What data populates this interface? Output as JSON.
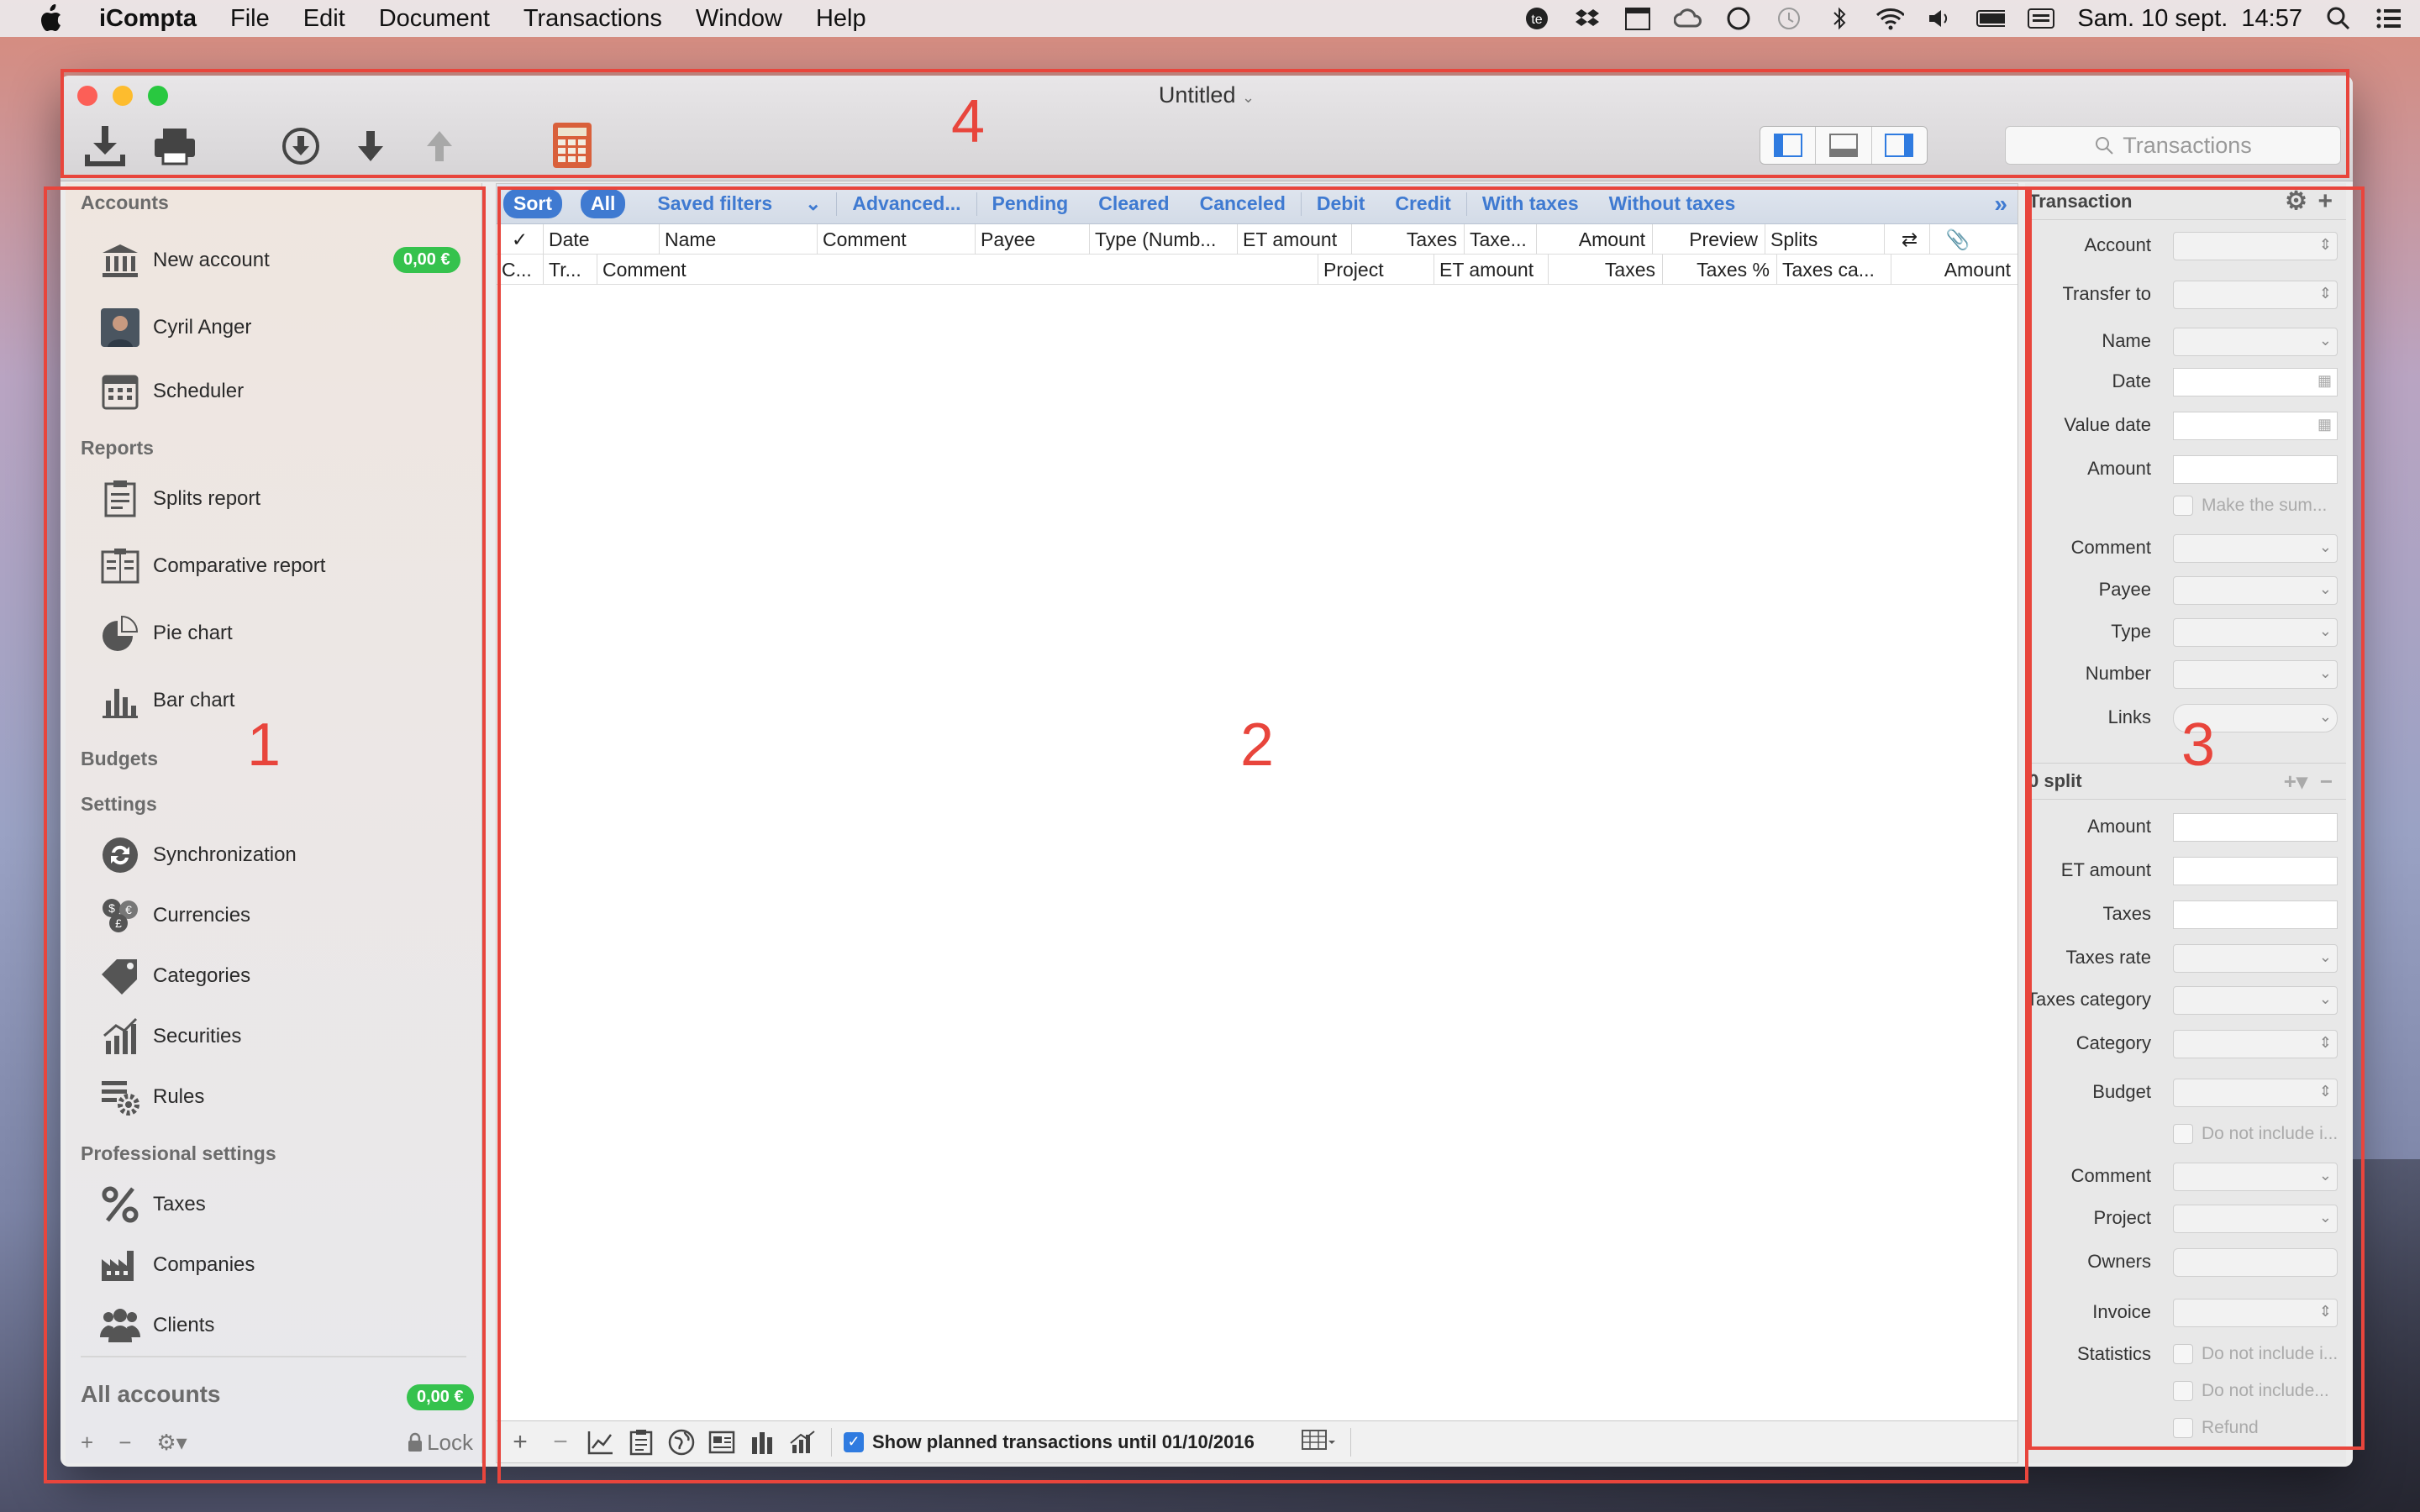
{
  "menubar": {
    "app": "iCompta",
    "items": [
      "File",
      "Edit",
      "Document",
      "Transactions",
      "Window",
      "Help"
    ],
    "datetime": "Sam. 10 sept.  14:57",
    "calendar_day": "10"
  },
  "window": {
    "title": "Untitled",
    "search_placeholder": "Transactions"
  },
  "sidebar": {
    "sections": {
      "accounts": "Accounts",
      "reports": "Reports",
      "budgets": "Budgets",
      "settings": "Settings",
      "professional": "Professional settings"
    },
    "items": {
      "new_account": "New account",
      "new_account_badge": "0,00 €",
      "cyril": "Cyril Anger",
      "scheduler": "Scheduler",
      "splits_report": "Splits report",
      "comparative_report": "Comparative report",
      "pie_chart": "Pie chart",
      "bar_chart": "Bar chart",
      "synchronization": "Synchronization",
      "currencies": "Currencies",
      "categories": "Categories",
      "securities": "Securities",
      "rules": "Rules",
      "taxes": "Taxes",
      "companies": "Companies",
      "clients": "Clients"
    },
    "all_accounts": "All accounts",
    "all_accounts_badge": "0,00 €",
    "lock": "Lock"
  },
  "filterbar": {
    "sort": "Sort",
    "all": "All",
    "saved_filters": "Saved filters",
    "advanced": "Advanced...",
    "pending": "Pending",
    "cleared": "Cleared",
    "canceled": "Canceled",
    "debit": "Debit",
    "credit": "Credit",
    "with_taxes": "With taxes",
    "without_taxes": "Without taxes"
  },
  "columns1": {
    "check": "✓",
    "date": "Date",
    "name": "Name",
    "comment": "Comment",
    "payee": "Payee",
    "type": "Type (Numb...",
    "et_amount": "ET amount",
    "taxes": "Taxes",
    "taxe": "Taxe...",
    "amount": "Amount",
    "preview": "Preview",
    "splits": "Splits"
  },
  "columns2": {
    "c": "C...",
    "tr": "Tr...",
    "comment": "Comment",
    "project": "Project",
    "et_amount": "ET amount",
    "taxes": "Taxes",
    "taxes_pct": "Taxes %",
    "taxes_ca": "Taxes ca...",
    "amount": "Amount"
  },
  "main_bottom": {
    "show_planned": "Show planned transactions until 01/10/2016"
  },
  "inspector": {
    "header": "Transaction",
    "account": "Account",
    "transfer_to": "Transfer to",
    "name": "Name",
    "date": "Date",
    "value_date": "Value date",
    "amount": "Amount",
    "make_sum": "Make the sum...",
    "comment": "Comment",
    "payee": "Payee",
    "type": "Type",
    "number": "Number",
    "links": "Links",
    "split_header": "0 split",
    "s_amount": "Amount",
    "s_et_amount": "ET amount",
    "s_taxes": "Taxes",
    "s_taxes_rate": "Taxes rate",
    "s_taxes_category": "Taxes category",
    "s_category": "Category",
    "s_budget": "Budget",
    "s_do_not_include": "Do not include i...",
    "s_comment": "Comment",
    "s_project": "Project",
    "s_owners": "Owners",
    "s_invoice": "Invoice",
    "s_statistics": "Statistics",
    "s_stat_1": "Do not include i...",
    "s_stat_2": "Do not include...",
    "s_refund": "Refund"
  },
  "annotations": [
    "1",
    "2",
    "3",
    "4"
  ],
  "colors": {
    "accent": "#3f7ad1",
    "badge": "#35c24d",
    "annotation": "#e8453c"
  }
}
